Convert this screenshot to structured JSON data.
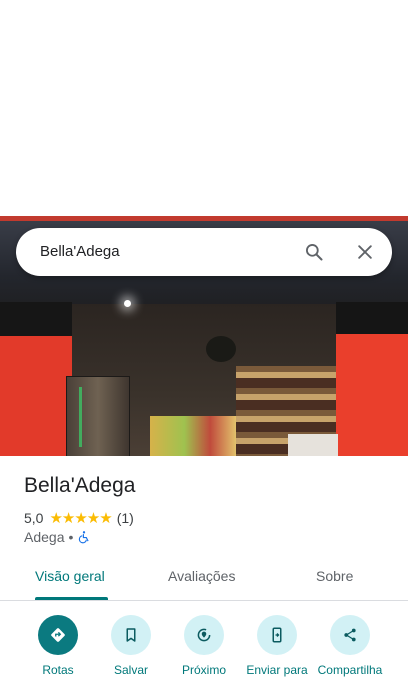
{
  "search": {
    "query": "Bella'Adega"
  },
  "place": {
    "name": "Bella'Adega",
    "rating": "5,0",
    "stars": "★★★★★",
    "review_count": "(1)",
    "category": "Adega",
    "separator": "•"
  },
  "tabs": [
    {
      "label": "Visão geral",
      "active": true
    },
    {
      "label": "Avaliações",
      "active": false
    },
    {
      "label": "Sobre",
      "active": false
    }
  ],
  "actions": [
    {
      "label": "Rotas",
      "icon": "directions-icon"
    },
    {
      "label": "Salvar",
      "icon": "bookmark-icon"
    },
    {
      "label": "Próximo",
      "icon": "nearby-icon"
    },
    {
      "label": "Enviar para",
      "icon": "send-to-phone-icon"
    },
    {
      "label": "Compartilha",
      "icon": "share-icon"
    }
  ],
  "colors": {
    "accent": "#00787a",
    "primary_button": "#0b7a80",
    "chip_bg": "#d2f1f5",
    "star": "#fbbc04"
  }
}
